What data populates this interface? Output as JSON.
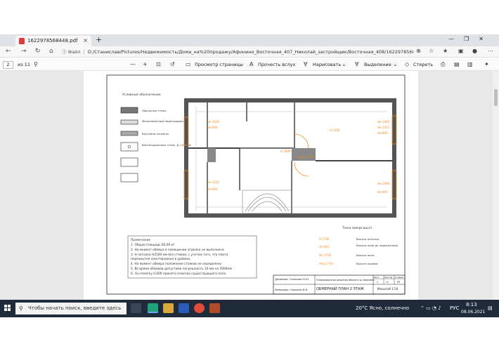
{
  "browser": {
    "tab_title": "1622978568448.pdf",
    "tab_close": "×",
    "new_tab": "+",
    "window_controls": [
      "—",
      "❐",
      "✕"
    ],
    "address_label": "Файл",
    "address_separator": "|",
    "url": "D:/Станислав/Pictures/Недвижимость/Дома_на%20продажу/Афонино_Восточная_407_Николай_застройщик/Восточная_408/1622978568448.pdf"
  },
  "pdf_toolbar": {
    "page_current": "2",
    "page_total": "из 11",
    "zoom_out": "—",
    "zoom_in": "+",
    "view_label": "Просмотр страницы",
    "read_aloud": "Прочесть вслух",
    "draw": "Нарисовать",
    "highlight": "Выделение",
    "erase": "Стереть"
  },
  "document": {
    "legend_title": "Условные обозначения",
    "legend_items": [
      "Наружные стены",
      "Межкомнатные перегородки",
      "Внутрени колонны",
      "Вентиляционные стояк, Д =180мм"
    ],
    "plan_labels": [
      "H 2508",
      "Ни 1440",
      "Ни 840",
      "Ни 1460",
      "Ни 1455",
      "Ни 840",
      "Ни 1415",
      "Ни 840",
      "Ни 1468",
      "Ни 840",
      "Н 2609",
      "Нкр 2540"
    ],
    "points_title": "Точки замера высот",
    "points_legend": [
      {
        "code": "Н 2782",
        "desc": "Высота потолка"
      },
      {
        "code": "Нп 801",
        "desc": "Высота пола до подоконника"
      },
      {
        "code": "Нп 1720",
        "desc": "Высота окна"
      },
      {
        "code": "Нпр 2740",
        "desc": "Высота проема"
      }
    ],
    "notes_title": "Примечание",
    "notes": [
      "1. Общая площадь 60,09 м²",
      "2. На момент обмера в помещении отделка не выполнена",
      "3. Н потолка Н2509 мм без стяжки, с учетом того, что плита",
      "перекрытия смонтирована в уровень",
      "4. На момент обмера положение стояков не определено",
      "5. Во время обмеров допустима погрешность 10 мм на 5000мм",
      "6. За отметку 0.000 принята отметка существующего пола"
    ],
    "stamp_designer": "Дизайнер: Глазкова Ю.Ю.",
    "stamp_checked": "Замерщик: Смирнов И.И.",
    "stamp_project": "Планировочное решение объекта д. Афонино.",
    "stamp_sheet_title": "ОБМЕРНЫЙ ПЛАН 2 ЭТАЖ",
    "stamp_headers": [
      "Лист",
      "Листов",
      "Стадия"
    ],
    "stamp_values": [
      "2",
      "11",
      "РП"
    ],
    "stamp_scale": "Масштаб 1:50"
  },
  "taskbar": {
    "search_placeholder": "Чтобы начать поиск, введите здесь запрос",
    "weather": "20°C  Ясно, солнечно",
    "language": "РУС",
    "time": "8:13",
    "date": "08.06.2021"
  },
  "colors": {
    "accent_orange": "#f28a1e",
    "wall_fill": "#8c8c8c",
    "taskbar": "#1f2a3a"
  }
}
